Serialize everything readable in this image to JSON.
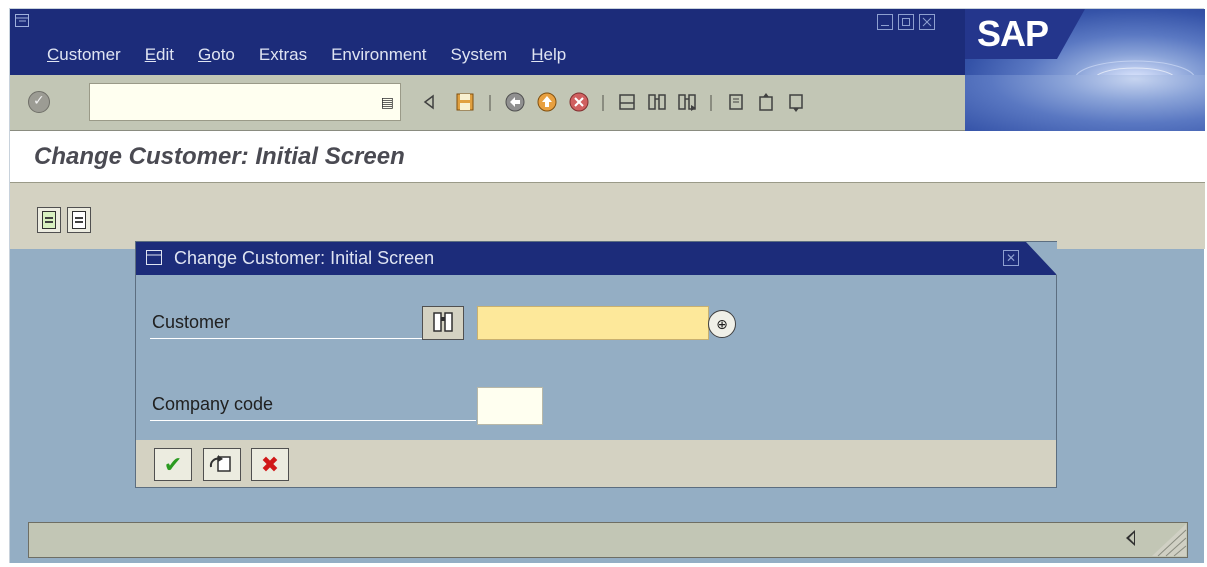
{
  "menubar": {
    "items": [
      "Customer",
      "Edit",
      "Goto",
      "Extras",
      "Environment",
      "System",
      "Help"
    ]
  },
  "logo": {
    "text": "SAP"
  },
  "command_field": {
    "value": ""
  },
  "screen": {
    "title": "Change Customer:  Initial Screen"
  },
  "dialog": {
    "title": "Change Customer:  Initial Screen",
    "fields": {
      "customer_label": "Customer",
      "customer_value": "",
      "company_code_label": "Company code",
      "company_code_value": ""
    }
  },
  "colors": {
    "title_bar": "#1c2c7a",
    "background": "#94aec4",
    "toolbar": "#c2c6b5",
    "input_required": "#fde89a",
    "input": "#fffff0"
  },
  "icons": [
    "enter-check-icon",
    "back-arrow-icon",
    "save-icon",
    "back-icon",
    "exit-icon",
    "cancel-icon",
    "print-icon",
    "find-icon",
    "find-next-icon",
    "first-page-icon",
    "previous-page-icon",
    "next-page-icon",
    "search-help-icon",
    "matchcode-icon",
    "continue-icon",
    "other-customer-icon",
    "cancel-x-icon"
  ]
}
